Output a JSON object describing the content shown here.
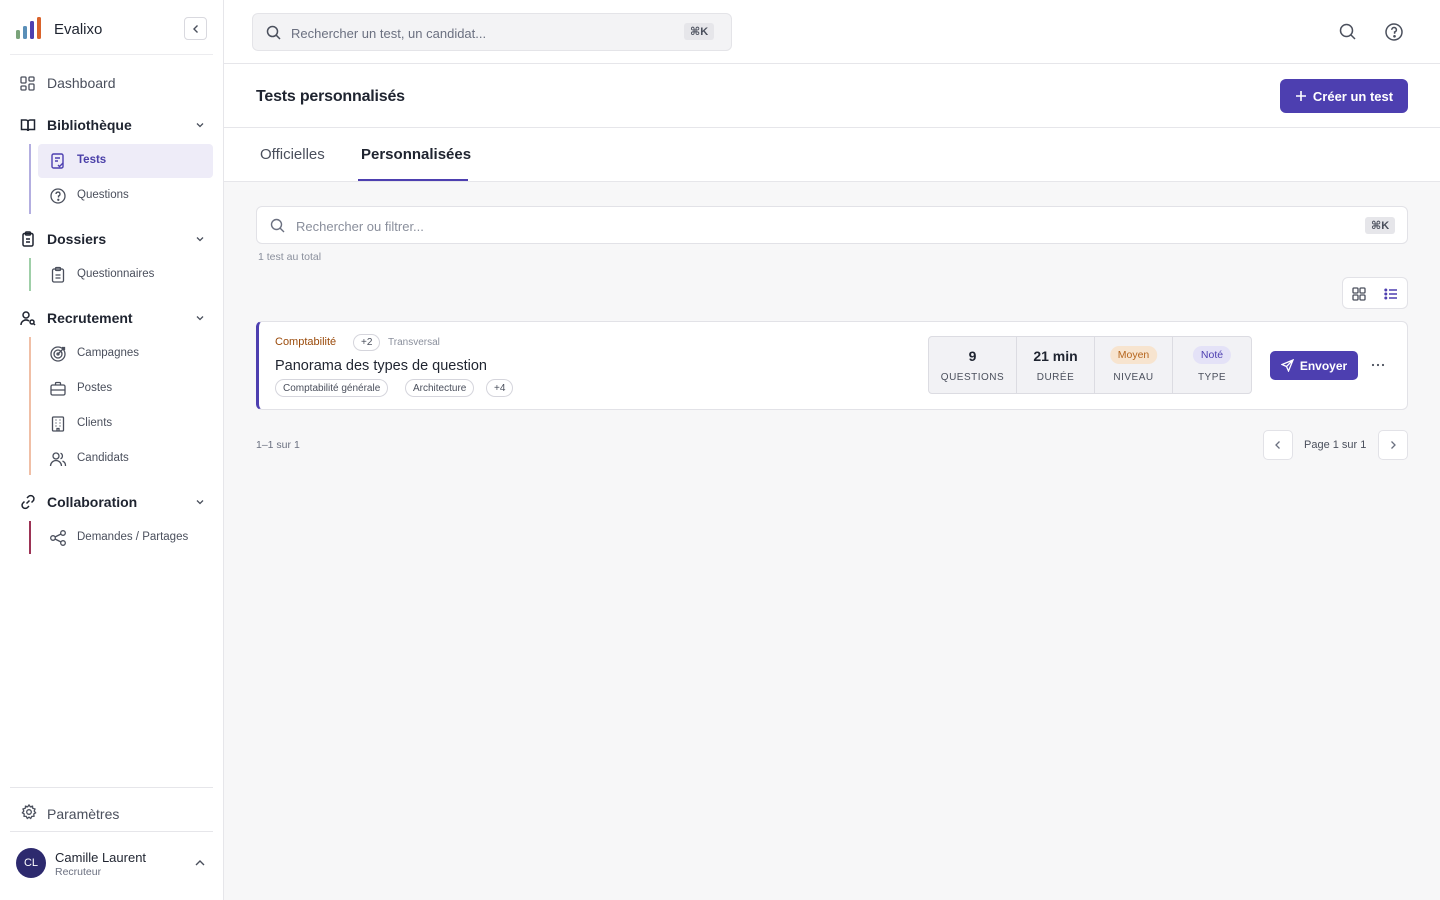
{
  "app": {
    "name": "Evalixo"
  },
  "sidebar": {
    "dashboard": "Dashboard",
    "sections": [
      {
        "label": "Bibliothèque",
        "items": [
          {
            "label": "Tests",
            "active": true
          },
          {
            "label": "Questions"
          }
        ]
      },
      {
        "label": "Dossiers",
        "items": [
          {
            "label": "Questionnaires"
          }
        ]
      },
      {
        "label": "Recrutement",
        "items": [
          {
            "label": "Campagnes"
          },
          {
            "label": "Postes"
          },
          {
            "label": "Clients"
          },
          {
            "label": "Candidats"
          }
        ]
      },
      {
        "label": "Collaboration",
        "items": [
          {
            "label": "Demandes / Partages"
          }
        ]
      }
    ],
    "settings": "Paramètres",
    "user": {
      "initials": "CL",
      "name": "Camille Laurent",
      "role": "Recruteur"
    }
  },
  "topbar": {
    "search_placeholder": "Rechercher un test, un candidat...",
    "shortcut": "⌘K"
  },
  "page": {
    "title": "Tests personnalisés",
    "create_label": "Créer un test"
  },
  "tabs": [
    {
      "label": "Officielles"
    },
    {
      "label": "Personnalisées",
      "active": true
    }
  ],
  "filter": {
    "placeholder": "Rechercher ou filtrer...",
    "shortcut": "⌘K",
    "count": "1 test au total"
  },
  "test_card": {
    "category": "Comptabilité",
    "category_more": "+2",
    "scope": "Transversal",
    "title": "Panorama des types de question",
    "tags": [
      "Comptabilité générale",
      "Architecture"
    ],
    "tags_more": "+4",
    "stats": {
      "questions": {
        "value": "9",
        "label": "QUESTIONS"
      },
      "duration": {
        "value": "21 min",
        "label": "DURÉE"
      },
      "level": {
        "value": "Moyen",
        "label": "NIVEAU"
      },
      "type": {
        "value": "Noté",
        "label": "TYPE"
      }
    },
    "send_label": "Envoyer",
    "more_label": "···"
  },
  "pagination": {
    "range": "1–1 sur 1",
    "page": "Page 1 sur 1"
  },
  "colors": {
    "accent": "#4d3fb0",
    "level_bg": "#f7e4cf",
    "level_fg": "#b5651d",
    "category": "#9a4a0a"
  }
}
